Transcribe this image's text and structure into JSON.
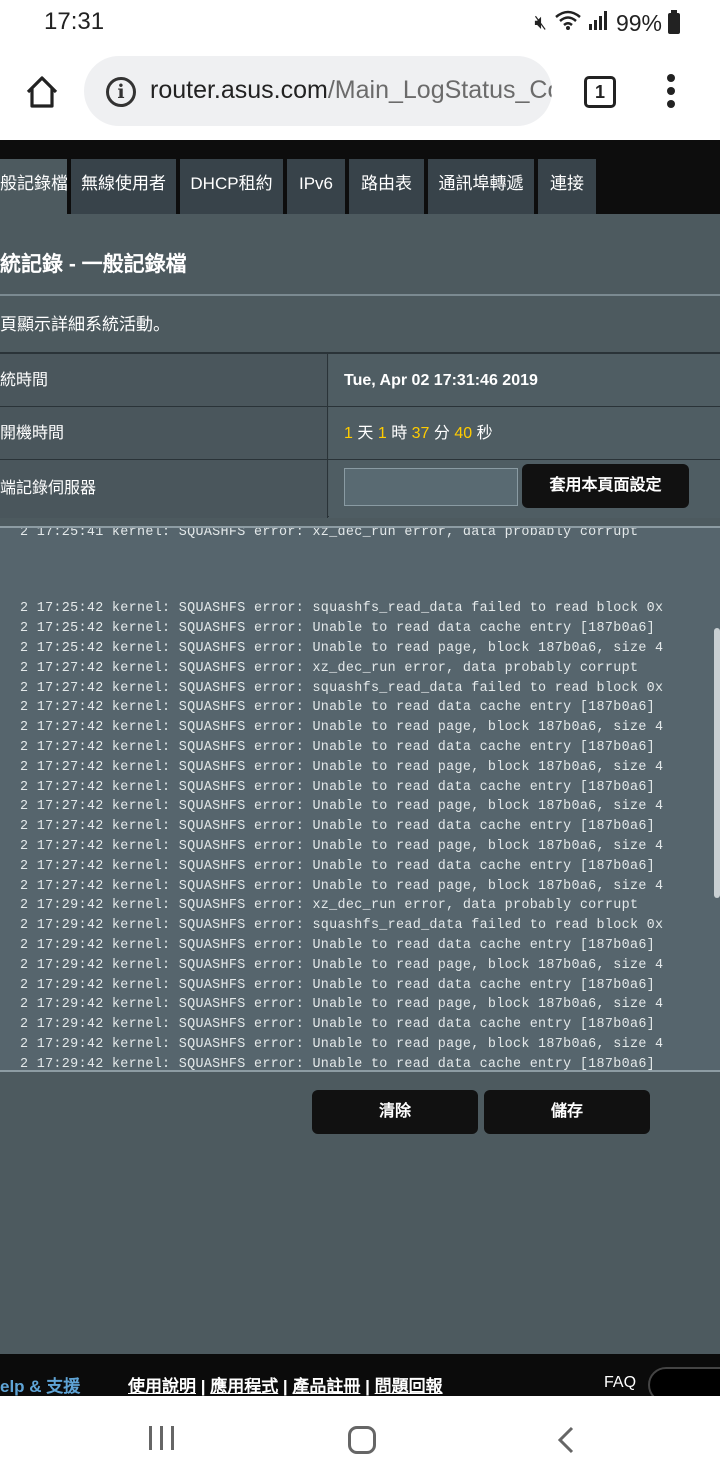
{
  "status_bar": {
    "time": "17:31",
    "battery": "99%",
    "icons": [
      "mute-icon",
      "wifi-icon",
      "signal-icon",
      "battery-icon"
    ]
  },
  "browser": {
    "url_domain": "router.asus.com",
    "url_path": "/Main_LogStatus_Cor",
    "tab_count": "1"
  },
  "tabs": [
    {
      "label": "般記錄檔",
      "active": true
    },
    {
      "label": "無線使用者",
      "active": false
    },
    {
      "label": "DHCP租約",
      "active": false
    },
    {
      "label": "IPv6",
      "active": false
    },
    {
      "label": "路由表",
      "active": false
    },
    {
      "label": "通訊埠轉遞",
      "active": false
    },
    {
      "label": "連接",
      "active": false
    }
  ],
  "page": {
    "title": "統記錄 - 一般記錄檔",
    "description": "頁顯示詳細系統活動。"
  },
  "info_rows": {
    "system_time_label": "統時間",
    "system_time_value": "Tue, Apr 02 17:31:46 2019",
    "uptime_label": "開機時間",
    "uptime": {
      "days": "1",
      "days_unit": "天",
      "hours": "1",
      "hours_unit": "時",
      "minutes": "37",
      "minutes_unit": "分",
      "seconds": "40",
      "seconds_unit": "秒"
    },
    "log_server_label": "端記錄伺服器",
    "log_server_value": "",
    "apply_button": "套用本頁面設定"
  },
  "log": {
    "partial_top_line": "2 17:25:41 kernel: SQUASHFS error: xz_dec_run error, data probably corrupt",
    "lines": [
      "2 17:25:42 kernel: SQUASHFS error: squashfs_read_data failed to read block 0x",
      "2 17:25:42 kernel: SQUASHFS error: Unable to read data cache entry [187b0a6]",
      "2 17:25:42 kernel: SQUASHFS error: Unable to read page, block 187b0a6, size 4",
      "2 17:27:42 kernel: SQUASHFS error: xz_dec_run error, data probably corrupt",
      "2 17:27:42 kernel: SQUASHFS error: squashfs_read_data failed to read block 0x",
      "2 17:27:42 kernel: SQUASHFS error: Unable to read data cache entry [187b0a6]",
      "2 17:27:42 kernel: SQUASHFS error: Unable to read page, block 187b0a6, size 4",
      "2 17:27:42 kernel: SQUASHFS error: Unable to read data cache entry [187b0a6]",
      "2 17:27:42 kernel: SQUASHFS error: Unable to read page, block 187b0a6, size 4",
      "2 17:27:42 kernel: SQUASHFS error: Unable to read data cache entry [187b0a6]",
      "2 17:27:42 kernel: SQUASHFS error: Unable to read page, block 187b0a6, size 4",
      "2 17:27:42 kernel: SQUASHFS error: Unable to read data cache entry [187b0a6]",
      "2 17:27:42 kernel: SQUASHFS error: Unable to read page, block 187b0a6, size 4",
      "2 17:27:42 kernel: SQUASHFS error: Unable to read data cache entry [187b0a6]",
      "2 17:27:42 kernel: SQUASHFS error: Unable to read page, block 187b0a6, size 4",
      "2 17:29:42 kernel: SQUASHFS error: xz_dec_run error, data probably corrupt",
      "2 17:29:42 kernel: SQUASHFS error: squashfs_read_data failed to read block 0x",
      "2 17:29:42 kernel: SQUASHFS error: Unable to read data cache entry [187b0a6]",
      "2 17:29:42 kernel: SQUASHFS error: Unable to read page, block 187b0a6, size 4",
      "2 17:29:42 kernel: SQUASHFS error: Unable to read data cache entry [187b0a6]",
      "2 17:29:42 kernel: SQUASHFS error: Unable to read page, block 187b0a6, size 4",
      "2 17:29:42 kernel: SQUASHFS error: Unable to read data cache entry [187b0a6]",
      "2 17:29:42 kernel: SQUASHFS error: Unable to read page, block 187b0a6, size 4",
      "2 17:29:42 kernel: SQUASHFS error: Unable to read data cache entry [187b0a6]",
      "2 17:29:42 kernel: SQUASHFS error: Unable to read page, block 187b0a6, size 4",
      "2 17:29:42 kernel: SQUASHFS error: Unable to read data cache entry [187b0a6]",
      "2 17:29:42 kernel: SQUASHFS error: Unable to read page, block 187b0a6, size 4"
    ]
  },
  "actions": {
    "clear": "清除",
    "save": "儲存"
  },
  "footer": {
    "help": "elp & 支援",
    "links": [
      "使用說明",
      "應用程式",
      "產品註冊",
      "問題回報"
    ],
    "separator": " | ",
    "faq": "FAQ"
  },
  "colors": {
    "accent_yellow": "#ffcc00",
    "help_blue": "#5fa4d6",
    "content_bg": "#4d5a5f"
  }
}
